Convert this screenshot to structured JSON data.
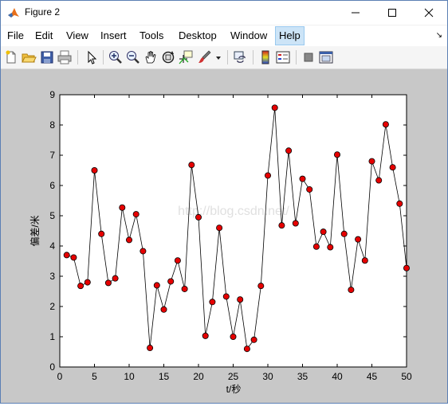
{
  "window": {
    "title": "Figure 2"
  },
  "menu": [
    {
      "label": "File"
    },
    {
      "label": "Edit"
    },
    {
      "label": "View"
    },
    {
      "label": "Insert"
    },
    {
      "label": "Tools"
    },
    {
      "label": "Desktop"
    },
    {
      "label": "Window"
    },
    {
      "label": "Help"
    }
  ],
  "toolbar": [
    "new-figure-icon",
    "open-file-icon",
    "save-icon",
    "print-icon",
    "pointer-icon",
    "zoom-in-icon",
    "zoom-out-icon",
    "pan-icon",
    "rotate-icon",
    "data-cursor-icon",
    "brush-icon",
    "link-icon",
    "colorbar-icon",
    "legend-icon",
    "hide-plot-tools-icon",
    "show-plot-tools-icon"
  ],
  "watermark": "http://blog.csdn.net/",
  "chart_data": {
    "type": "line",
    "xlabel": "t/秒",
    "ylabel": "偏差/米",
    "xlim": [
      0,
      50
    ],
    "ylim": [
      0,
      9
    ],
    "xticks": [
      0,
      5,
      10,
      15,
      20,
      25,
      30,
      35,
      40,
      45,
      50
    ],
    "yticks": [
      0,
      1,
      2,
      3,
      4,
      5,
      6,
      7,
      8,
      9
    ],
    "marker_color": "#e60000",
    "line_color": "#000000",
    "x": [
      1,
      2,
      3,
      4,
      5,
      6,
      7,
      8,
      9,
      10,
      11,
      12,
      13,
      14,
      15,
      16,
      17,
      18,
      19,
      20,
      21,
      22,
      23,
      24,
      25,
      26,
      27,
      28,
      29,
      30,
      31,
      32,
      33,
      34,
      35,
      36,
      37,
      38,
      39,
      40,
      41,
      42,
      43,
      44,
      45,
      46,
      47,
      48,
      49,
      50
    ],
    "y": [
      3.7,
      3.62,
      2.68,
      2.8,
      6.5,
      4.4,
      2.78,
      2.93,
      5.27,
      4.2,
      5.05,
      3.83,
      0.63,
      2.7,
      1.9,
      2.83,
      3.52,
      2.58,
      6.68,
      4.95,
      1.03,
      2.15,
      4.6,
      2.33,
      1.0,
      2.23,
      0.6,
      0.9,
      2.68,
      6.33,
      8.57,
      4.68,
      7.15,
      4.75,
      6.22,
      5.87,
      3.98,
      4.47,
      3.96,
      7.02,
      4.4,
      2.55,
      4.22,
      3.52,
      6.8,
      6.17,
      8.02,
      6.6,
      5.4,
      3.27
    ]
  }
}
